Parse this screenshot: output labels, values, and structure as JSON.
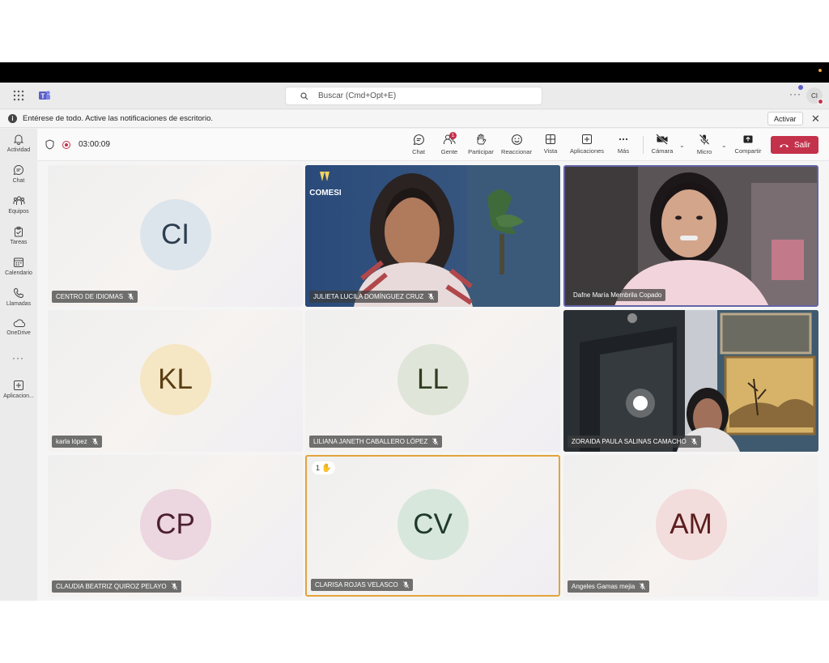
{
  "topbar": {
    "search_placeholder": "Buscar (Cmd+Opt+E)",
    "more": "···",
    "user_initials": "CI"
  },
  "notification": {
    "text": "Entérese de todo. Active las notificaciones de escritorio.",
    "button": "Activar"
  },
  "sidebar": {
    "items": [
      {
        "label": "Actividad",
        "icon": "bell-icon"
      },
      {
        "label": "Chat",
        "icon": "chat-icon"
      },
      {
        "label": "Equipos",
        "icon": "teams-icon"
      },
      {
        "label": "Tareas",
        "icon": "tasks-icon"
      },
      {
        "label": "Calendario",
        "icon": "calendar-icon"
      },
      {
        "label": "Llamadas",
        "icon": "phone-icon"
      },
      {
        "label": "OneDrive",
        "icon": "cloud-icon"
      },
      {
        "label": "Aplicacion...",
        "icon": "add-app-icon"
      }
    ],
    "more": "···"
  },
  "call": {
    "timer": "03:00:09",
    "controls": {
      "chat": "Chat",
      "people": "Gente",
      "people_count": "1",
      "raise": "Participar",
      "react": "Reaccionar",
      "view": "Vista",
      "apps": "Aplicaciones",
      "more": "Más",
      "camera": "Cámara",
      "mic": "Micro",
      "share": "Compartir",
      "leave": "Salir"
    },
    "colors": {
      "leave": "#c4314b",
      "raised_border": "#e3a33b",
      "selected_border": "#6264a7"
    }
  },
  "participants": [
    {
      "name": "CENTRO DE IDIOMAS",
      "initials": "CI",
      "avatar_color": "#dde5ec",
      "text_color": "#2c3e50",
      "video": false
    },
    {
      "name": "JULIETA LUCILA DOMÍNGUEZ CRUZ",
      "initials": "",
      "video": true,
      "logo_text": "COMESI"
    },
    {
      "name": "Dafne María Membrila Copado",
      "initials": "",
      "video": true
    },
    {
      "name": "karla lópez",
      "initials": "KL",
      "avatar_color": "#f5e6c4",
      "text_color": "#5a3e12",
      "video": false
    },
    {
      "name": "LILIANA JANETH CABALLERO LÓPEZ",
      "initials": "LL",
      "avatar_color": "#dfe5d8",
      "text_color": "#2f3d22",
      "video": false
    },
    {
      "name": "ZORAIDA PAULA SALINAS CAMACHO",
      "initials": "",
      "video": true
    },
    {
      "name": "CLAUDIA BEATRIZ QUIROZ PELAYO",
      "initials": "CP",
      "avatar_color": "#ecd6e0",
      "text_color": "#4d1f32",
      "video": false
    },
    {
      "name": "CLARISA ROJAS VELASCO",
      "initials": "CV",
      "avatar_color": "#d8e7dc",
      "text_color": "#1f3b2a",
      "video": false,
      "hand_count": "1"
    },
    {
      "name": "Angeles Gamas mejia",
      "initials": "AM",
      "avatar_color": "#f3dcdc",
      "text_color": "#5b1d1d",
      "video": false
    }
  ]
}
